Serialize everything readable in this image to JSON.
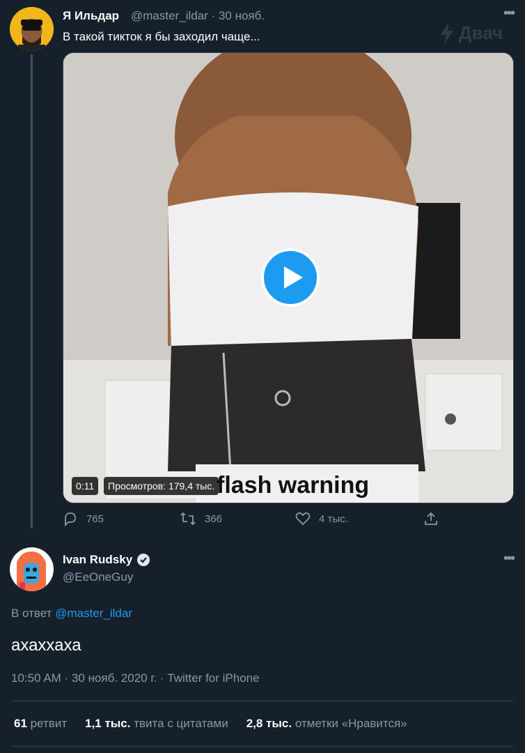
{
  "tweet1": {
    "author_name": "Я Ильдар",
    "handle": "@master_ildar",
    "separator": "·",
    "date": "30 нояб.",
    "text": "В такой тикток я бы заходил чаще...",
    "more_glyph": "•••",
    "watermark": "Двач",
    "video": {
      "duration": "0:11",
      "views": "Просмотров: 179,4 тыс.",
      "overlay_text": "flash warning"
    },
    "actions": {
      "replies": "765",
      "retweets": "366",
      "likes": "4 тыс."
    }
  },
  "tweet2": {
    "author_name": "Ivan Rudsky",
    "handle": "@EeOneGuy",
    "more_glyph": "•••",
    "reply_prefix": "В ответ",
    "reply_to": "@master_ildar",
    "text": "ахаххаха",
    "meta": "10:50 AM · 30 нояб. 2020 г. · Twitter for iPhone",
    "stats": {
      "retweets_count": "61",
      "retweets_label": "ретвит",
      "quotes_count": "1,1 тыс.",
      "quotes_label": "твита с цитатами",
      "likes_count": "2,8 тыс.",
      "likes_label": "отметки «Нравится»"
    }
  },
  "colors": {
    "background": "#15202b",
    "accent": "#1d9bf0",
    "muted": "#8899a6"
  }
}
